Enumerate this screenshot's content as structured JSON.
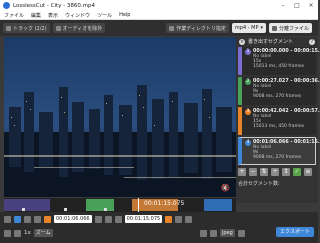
{
  "window": {
    "title": "LosslessCut - City - 3860.mp4"
  },
  "menu": [
    "ファイル",
    "編集",
    "表示",
    "ウィンドウ",
    "ツール",
    "Help"
  ],
  "toolbar": {
    "track_label": "トラック (2/2)",
    "audio_label": "オーディオを除外",
    "workdir_label": "作業ディレクトリ指定",
    "format_label": "mp4 - MP",
    "separate_label": "分離ファイル"
  },
  "panel": {
    "heading": "書き出すセグメント",
    "segments": [
      {
        "num": "1",
        "range": "00:00:00.000 - 00:00:15.050",
        "label": "No label",
        "duration": "15s",
        "frames": "15013 ms, 450 frames",
        "color": "#7a6fd0"
      },
      {
        "num": "2",
        "range": "00:00:27.027 - 00:00:36.055",
        "label": "No label",
        "duration": "9s",
        "frames": "9008 ms, 270 frames",
        "color": "#4aa15a"
      },
      {
        "num": "3",
        "range": "00:00:42.042 - 00:00:57.057",
        "label": "No label",
        "duration": "15s",
        "frames": "15013 ms, 450 frames",
        "color": "#e8852a"
      },
      {
        "num": "4",
        "range": "00:01:06.066 - 00:01:15.075",
        "label": "No label",
        "duration": "9s",
        "frames": "9008 ms, 270 frames",
        "color": "#3e86d8"
      }
    ],
    "total_label": "合計セグメント数:"
  },
  "timeline": {
    "time": "00:01:15.075"
  },
  "controls": {
    "segment_start": "00:01:06.066",
    "segment_end": "00:01:15.075",
    "zoom": "1x",
    "zoom_mode": "ズーム",
    "format": "jpeg",
    "export_label": "エクスポート"
  }
}
